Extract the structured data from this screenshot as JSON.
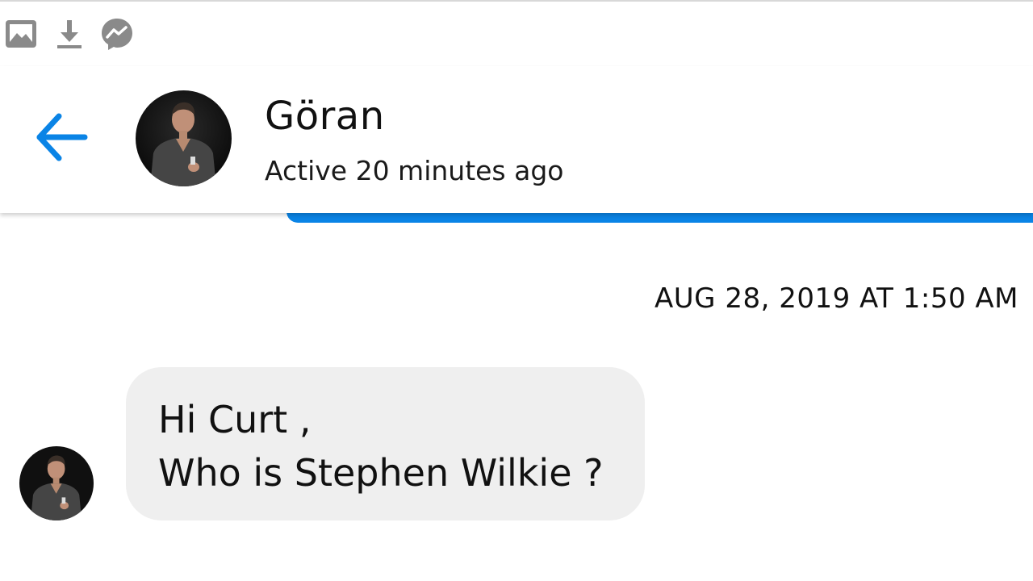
{
  "status_bar": {
    "icons": [
      "image-icon",
      "download-icon",
      "messenger-icon"
    ]
  },
  "header": {
    "back_icon": "arrow-left-icon",
    "contact_name": "Göran",
    "contact_status": "Active 20 minutes ago",
    "accent_color": "#0a84e6"
  },
  "conversation": {
    "timestamp": "AUG 28, 2019 AT 1:50 AM",
    "messages": [
      {
        "sender": "Göran",
        "lines": [
          "Hi Curt ,",
          "Who is Stephen Wilkie ?"
        ],
        "bubble_color": "#efefef"
      }
    ]
  }
}
